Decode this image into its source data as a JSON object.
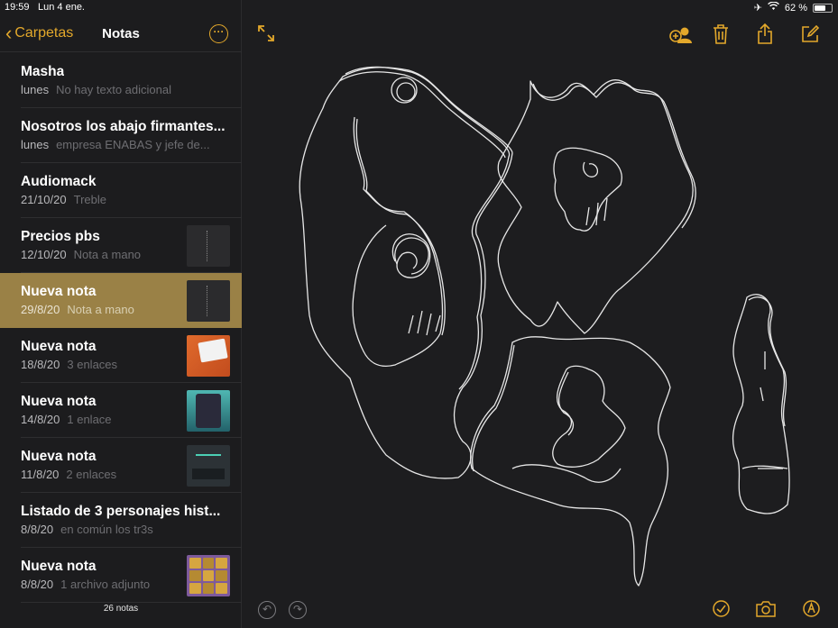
{
  "status_bar": {
    "time": "19:59",
    "date": "Lun 4 ene.",
    "battery": "62 %",
    "battery_level": 0.62
  },
  "sidebar": {
    "back_label": "Carpetas",
    "title": "Notas",
    "notes": [
      {
        "title": "Masha",
        "date": "lunes",
        "subtitle": "No hay texto adicional",
        "thumb": ""
      },
      {
        "title": "Nosotros los abajo firmantes...",
        "date": "lunes",
        "subtitle": "empresa ENABAS y jefe de...",
        "thumb": ""
      },
      {
        "title": "Audiomack",
        "date": "21/10/20",
        "subtitle": "Treble",
        "thumb": ""
      },
      {
        "title": "Precios pbs",
        "date": "12/10/20",
        "subtitle": "Nota a mano",
        "thumb": "sketch"
      },
      {
        "title": "Nueva nota",
        "date": "29/8/20",
        "subtitle": "Nota a mano",
        "thumb": "sketch",
        "selected": true
      },
      {
        "title": "Nueva nota",
        "date": "18/8/20",
        "subtitle": "3 enlaces",
        "thumb": "orange"
      },
      {
        "title": "Nueva nota",
        "date": "14/8/20",
        "subtitle": "1 enlace",
        "thumb": "teal"
      },
      {
        "title": "Nueva nota",
        "date": "11/8/20",
        "subtitle": "2 enlaces",
        "thumb": "dark"
      },
      {
        "title": "Listado de 3 personajes hist...",
        "date": "8/8/20",
        "subtitle": "en común los tr3s",
        "thumb": ""
      },
      {
        "title": "Nueva nota",
        "date": "8/8/20",
        "subtitle": "1 archivo adjunto",
        "thumb": "grid"
      }
    ],
    "count": "26 notas"
  },
  "editor": {
    "icons": [
      "expand-icon",
      "add-person-icon",
      "trash-icon",
      "share-icon",
      "compose-icon",
      "undo-icon",
      "redo-icon",
      "checklist-icon",
      "camera-icon",
      "markup-icon"
    ]
  },
  "colors": {
    "accent": "#e3a82b",
    "selected_row": "#9a8146",
    "background": "#1c1c1e"
  }
}
